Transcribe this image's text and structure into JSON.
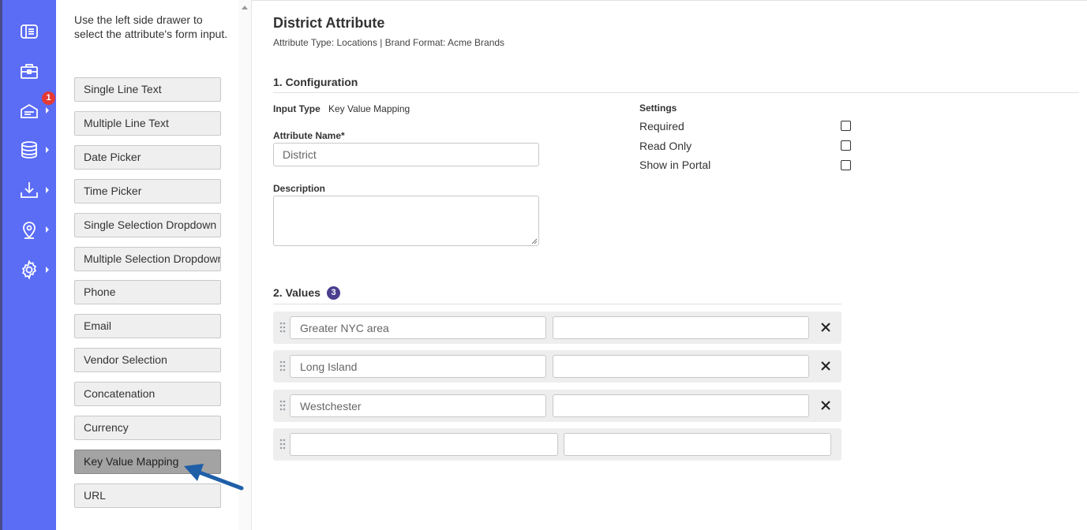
{
  "rail": {
    "items": [
      {
        "icon": "panel-icon",
        "has_caret": false
      },
      {
        "icon": "briefcase-icon",
        "has_caret": false
      },
      {
        "icon": "inbox-tray-icon",
        "has_caret": true,
        "badge": "1"
      },
      {
        "icon": "database-icon",
        "has_caret": true
      },
      {
        "icon": "download-icon",
        "has_caret": true
      },
      {
        "icon": "map-pin-icon",
        "has_caret": true
      },
      {
        "icon": "gear-icon",
        "has_caret": true
      }
    ],
    "accent": "#5b6cf5"
  },
  "drawer": {
    "help_text": "Use the left side drawer to select the attribute's form input.",
    "buttons": [
      "Single Line Text",
      "Multiple Line Text",
      "Date Picker",
      "Time Picker",
      "Single Selection Dropdown",
      "Multiple Selection Dropdown",
      "Phone",
      "Email",
      "Vendor Selection",
      "Concatenation",
      "Currency",
      "Key Value Mapping",
      "URL"
    ],
    "active": "Key Value Mapping"
  },
  "header": {
    "title": "District Attribute",
    "subtitle": "Attribute Type: Locations | Brand Format: Acme Brands"
  },
  "configuration": {
    "section_title": "1. Configuration",
    "input_type_label": "Input Type",
    "input_type_value": "Key Value Mapping",
    "attribute_name_label": "Attribute Name*",
    "attribute_name_value": "District",
    "description_label": "Description",
    "description_value": "",
    "settings_label": "Settings",
    "settings": [
      {
        "label": "Required",
        "checked": false
      },
      {
        "label": "Read Only",
        "checked": false
      },
      {
        "label": "Show in Portal",
        "checked": false
      }
    ]
  },
  "values": {
    "section_title": "2. Values",
    "count": "3",
    "rows": [
      {
        "key": "Greater NYC area",
        "value": ""
      },
      {
        "key": "Long Island",
        "value": ""
      },
      {
        "key": "Westchester",
        "value": ""
      },
      {
        "key": "",
        "value": ""
      }
    ]
  },
  "colors": {
    "badge_red": "#e53935",
    "count_badge": "#4a3e8e",
    "annotation_arrow": "#1f5fa8"
  }
}
